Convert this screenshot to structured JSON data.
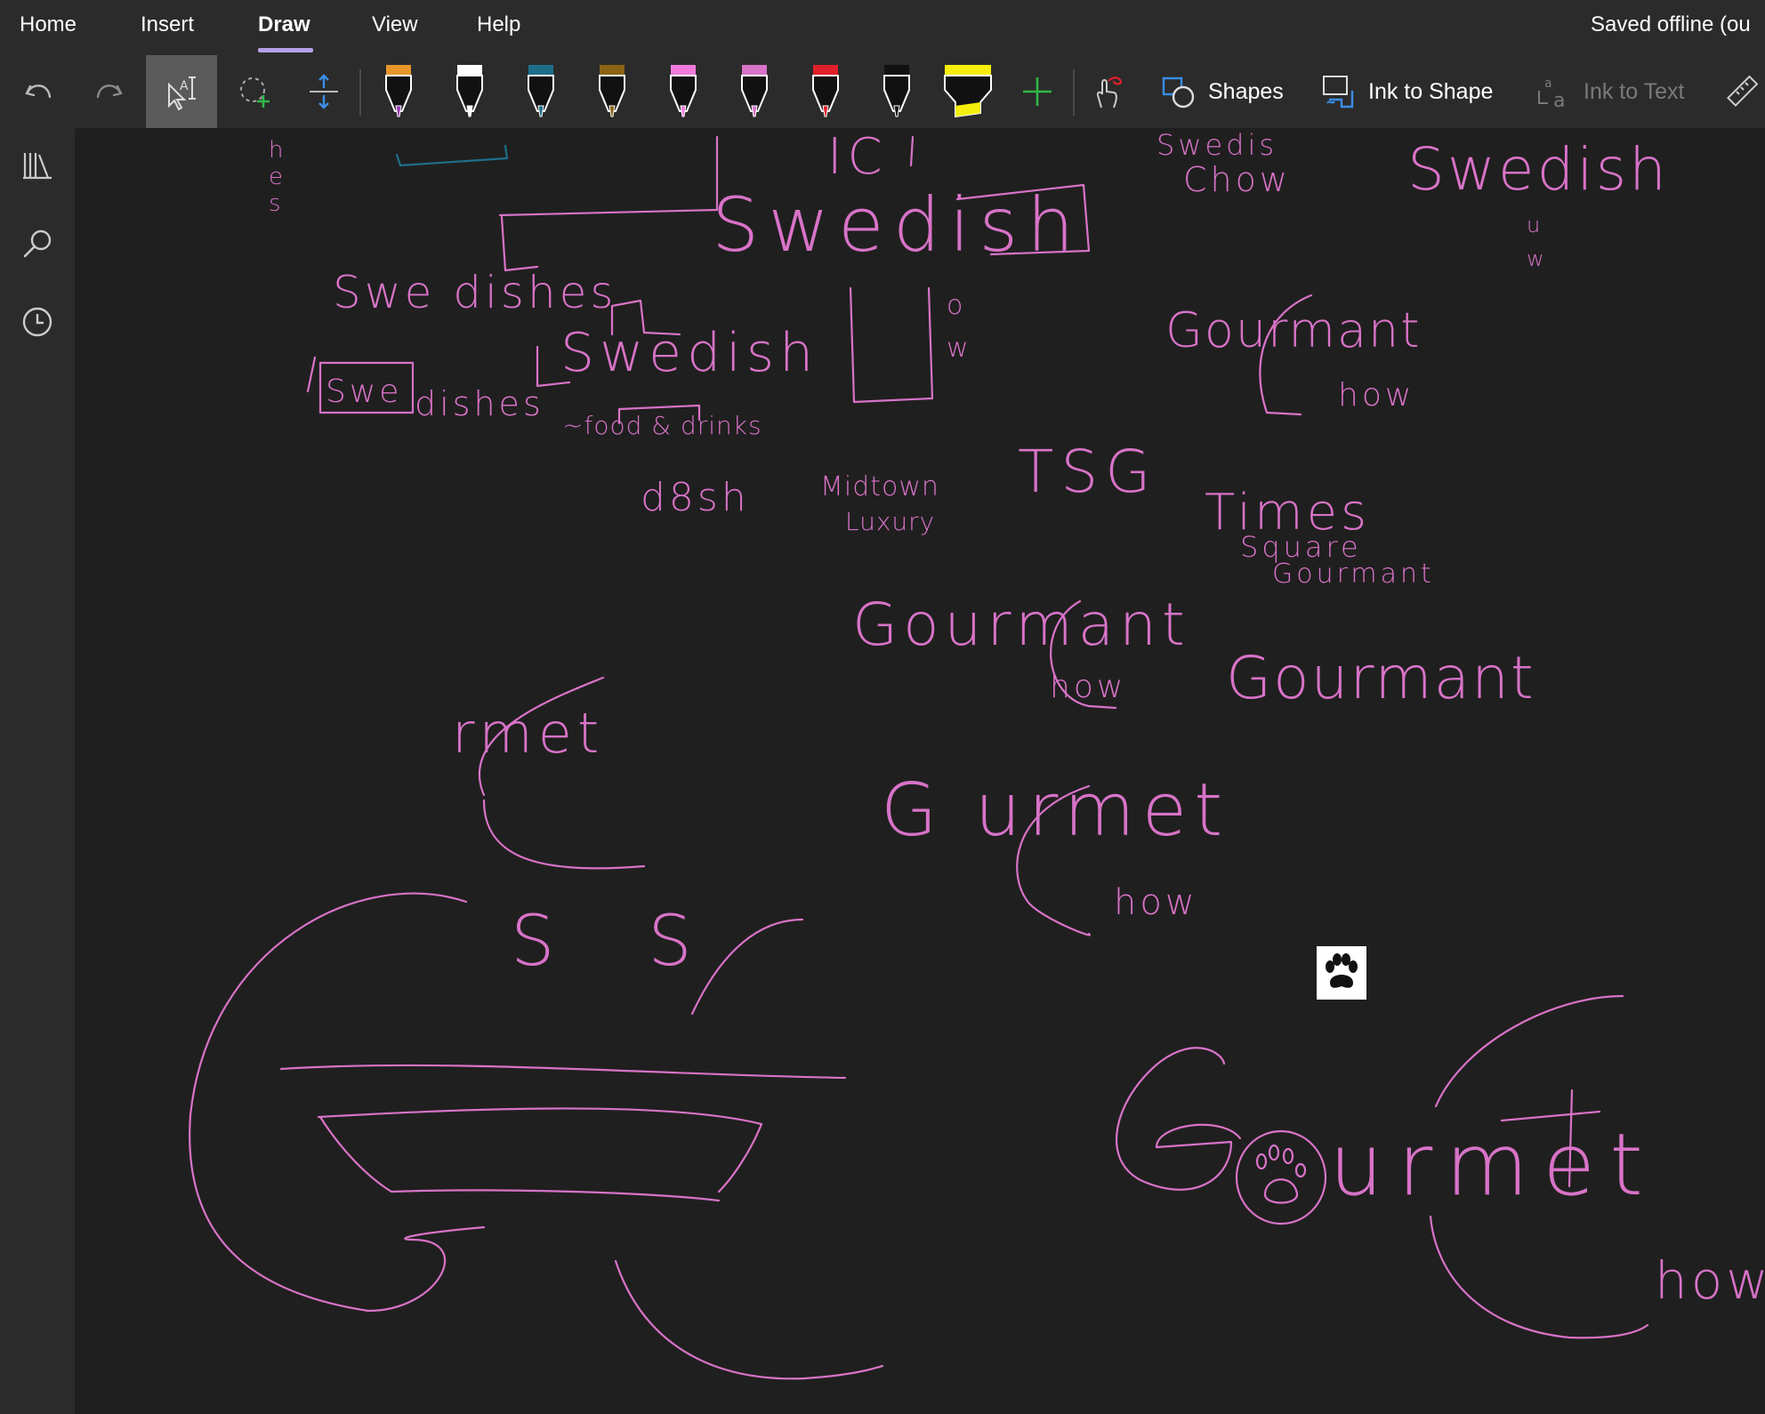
{
  "menu": {
    "tabs": [
      {
        "label": "Home"
      },
      {
        "label": "Insert"
      },
      {
        "label": "Draw"
      },
      {
        "label": "View"
      },
      {
        "label": "Help"
      }
    ],
    "active_tab": "Draw",
    "status": "Saved offline (ou"
  },
  "toolbar": {
    "shapes_label": "Shapes",
    "ink_to_shape_label": "Ink to Shape",
    "ink_to_text_label": "Ink to Text",
    "pens": [
      {
        "name": "orange-purple-pen",
        "cap": "#e8952a",
        "tip": "#9b3ab5"
      },
      {
        "name": "white-pen",
        "cap": "#ffffff",
        "tip": "#ffffff"
      },
      {
        "name": "teal-pen",
        "cap": "#1e6e8a",
        "tip": "#1e6e8a"
      },
      {
        "name": "brown-pen",
        "cap": "#8a6414",
        "tip": "#8a6414"
      },
      {
        "name": "pink-glitter-pen",
        "cap": "#f07adc",
        "tip": "#f07adc"
      },
      {
        "name": "light-pink-pen",
        "cap": "#d873c8",
        "tip": "#d873c8"
      },
      {
        "name": "red-pen",
        "cap": "#e0202a",
        "tip": "#e0202a"
      },
      {
        "name": "black-pen",
        "cap": "#111111",
        "tip": "#111111"
      },
      {
        "name": "yellow-highlighter",
        "cap": "#f5ee0c",
        "tip": "#f5ee0c"
      }
    ]
  },
  "ink": {
    "color": "#d873c8",
    "words": {
      "swedish_big": "Swedish",
      "swedish_tr": "Swedish",
      "swedis_chow": "Swedis",
      "chow": "Chow",
      "swe_dishes_1": "Swe dishes",
      "swe_dishes_2": "dishes",
      "swe_box": "Swe",
      "swedish_mid": "Swedish",
      "food_drinks": "~food & drinks",
      "dish": "d8sh",
      "midtown": "Midtown",
      "luxury": "Luxury",
      "tsg": "TSG",
      "times": "Times",
      "square": "Square",
      "gourmant_ts": "Gourmant",
      "gourmant_1": "Gourmant",
      "how_1": "how",
      "gourmant_2": "Gourmant",
      "how_2": "how",
      "gourmant_3": "Gourmant",
      "rmet": "rmet",
      "gurmet": "G urmet",
      "how_3": "how",
      "ss": "S S",
      "gourmet_big": "urmet",
      "how_big": "how",
      "ow": "o\nw",
      "uw": "u\nw",
      "hes": "h\ne\ns",
      "ic": "IC"
    }
  }
}
